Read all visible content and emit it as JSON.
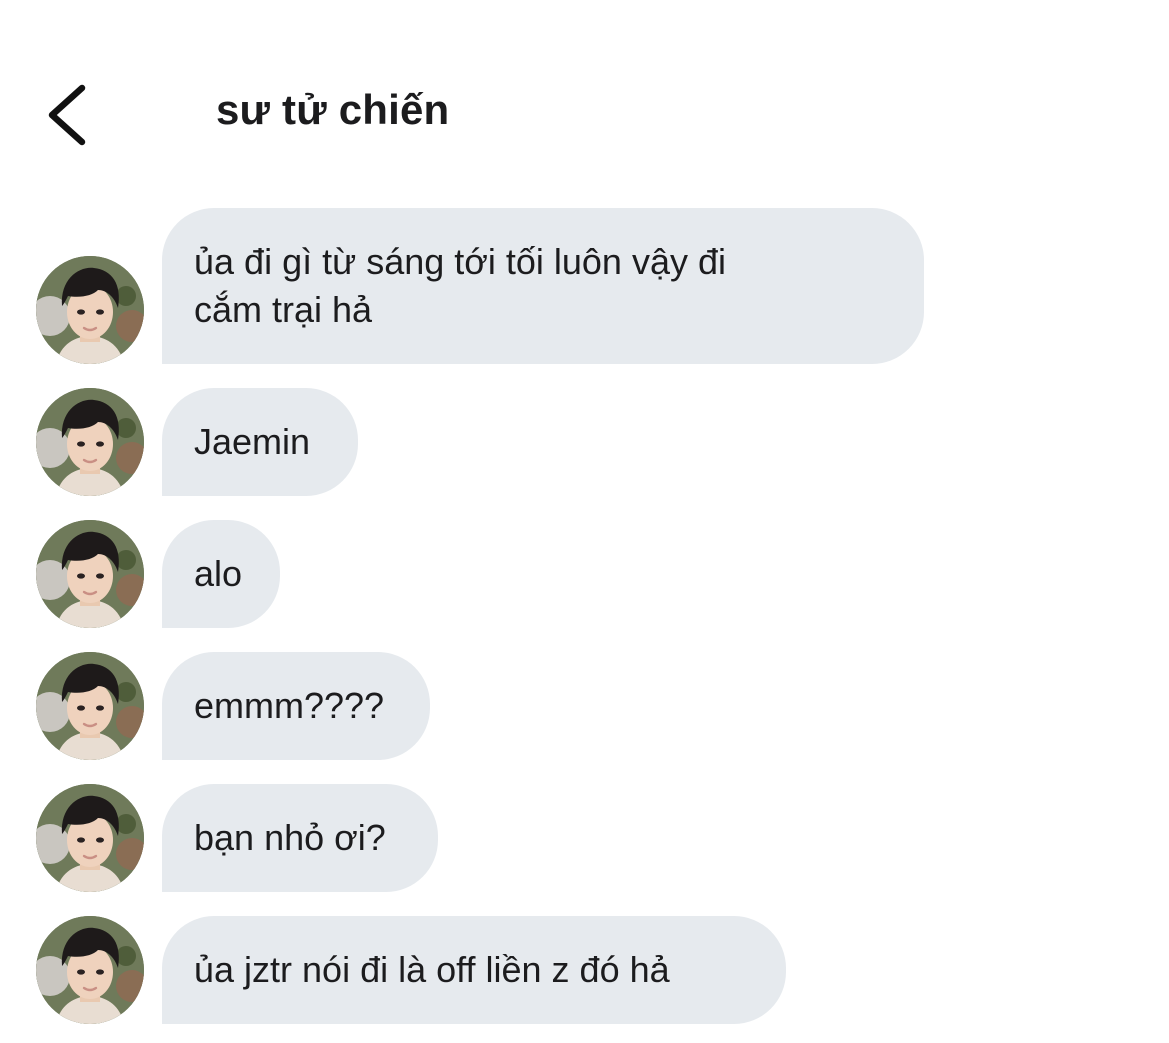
{
  "header": {
    "back_icon": "chevron-left-icon",
    "title": "sư tử chiến"
  },
  "messages": [
    {
      "text": "ủa đi gì từ sáng tới tối luôn vậy đi\ncắm trại hả"
    },
    {
      "text": "Jaemin"
    },
    {
      "text": "alo"
    },
    {
      "text": "emmm????"
    },
    {
      "text": "bạn nhỏ ơi?"
    },
    {
      "text": "ủa jztr nói đi là off liền z đó hả"
    }
  ],
  "colors": {
    "bubble_bg": "#e6eaee",
    "text": "#1c1c1e",
    "background": "#ffffff"
  }
}
